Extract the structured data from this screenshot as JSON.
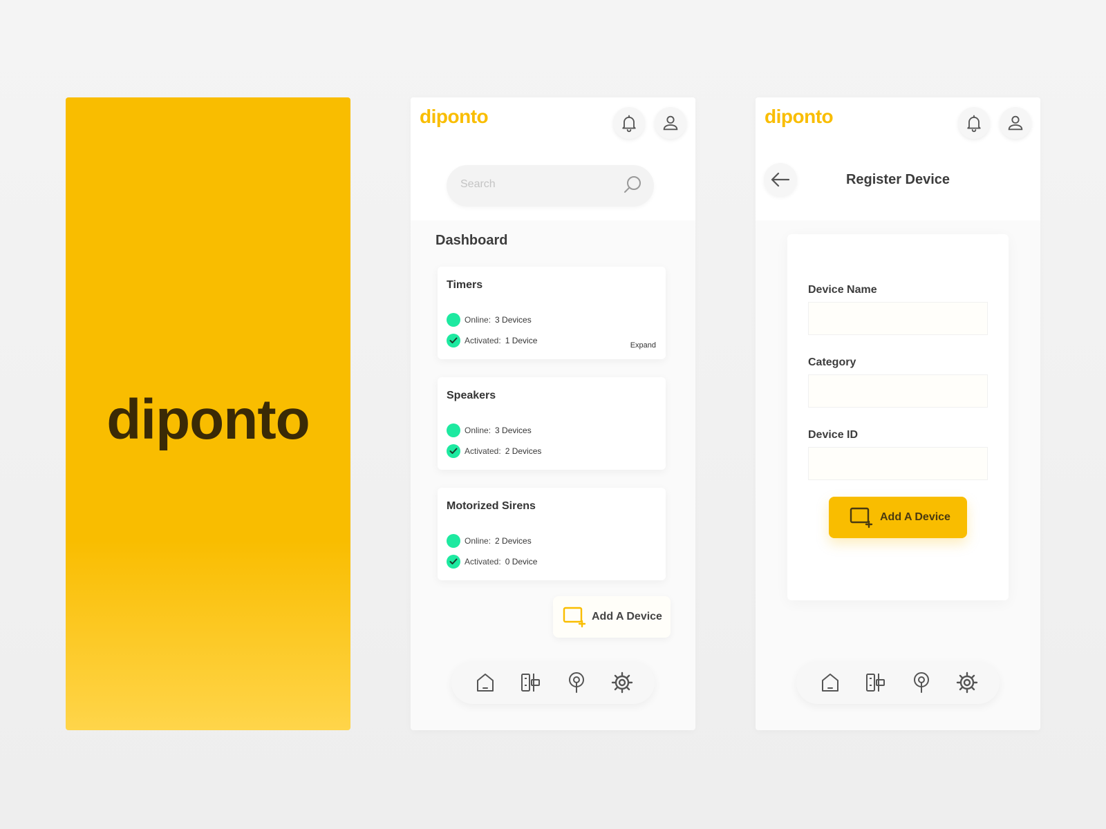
{
  "brand": {
    "logo_text": "diponto",
    "accent_color": "#f9bd00",
    "online_color": "#1de9a0"
  },
  "splash": {
    "logo_text": "diponto"
  },
  "header": {
    "notifications_icon": "bell-icon",
    "profile_icon": "user-icon"
  },
  "dashboard": {
    "search_placeholder": "Search",
    "title": "Dashboard",
    "cards": [
      {
        "title": "Timers",
        "online_label": "Online:",
        "online_value": "3 Devices",
        "activated_label": "Activated:",
        "activated_value": "1 Device",
        "expand_label": "Expand"
      },
      {
        "title": "Speakers",
        "online_label": "Online:",
        "online_value": "3 Devices",
        "activated_label": "Activated:",
        "activated_value": "2 Devices"
      },
      {
        "title": "Motorized Sirens",
        "online_label": "Online:",
        "online_value": "2 Devices",
        "activated_label": "Activated:",
        "activated_value": "0 Device"
      }
    ],
    "add_device_label": "Add A Device"
  },
  "register": {
    "title": "Register Device",
    "fields": [
      {
        "label": "Device Name",
        "value": ""
      },
      {
        "label": "Category",
        "value": ""
      },
      {
        "label": "Device ID",
        "value": ""
      }
    ],
    "submit_label": "Add A Device"
  },
  "nav": {
    "items": [
      {
        "icon": "home-icon"
      },
      {
        "icon": "devices-icon"
      },
      {
        "icon": "location-pin-icon"
      },
      {
        "icon": "settings-gear-icon"
      }
    ]
  }
}
